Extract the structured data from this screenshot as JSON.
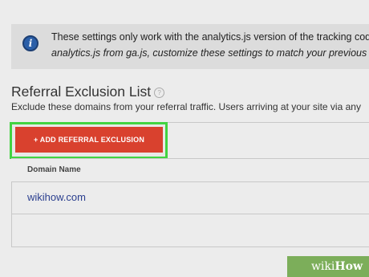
{
  "notice": {
    "line1": "These settings only work with the analytics.js version of the tracking cod",
    "line2": "analytics.js from ga.js, customize these settings to match your previous",
    "icon": "info-icon"
  },
  "section": {
    "title": "Referral Exclusion List",
    "description": "Exclude these domains from your referral traffic. Users arriving at your site via any"
  },
  "toolbar": {
    "add_label": "+ ADD REFERRAL EXCLUSION"
  },
  "table": {
    "columns": [
      "Domain Name"
    ],
    "rows": [
      {
        "domain": "wikihow.com"
      }
    ]
  },
  "watermark": {
    "prefix": "wiki",
    "suffix": "How"
  },
  "colors": {
    "accent_button": "#d9412e",
    "highlight": "#42d341",
    "link": "#2b3f8f",
    "info_icon": "#2b5fa8"
  }
}
